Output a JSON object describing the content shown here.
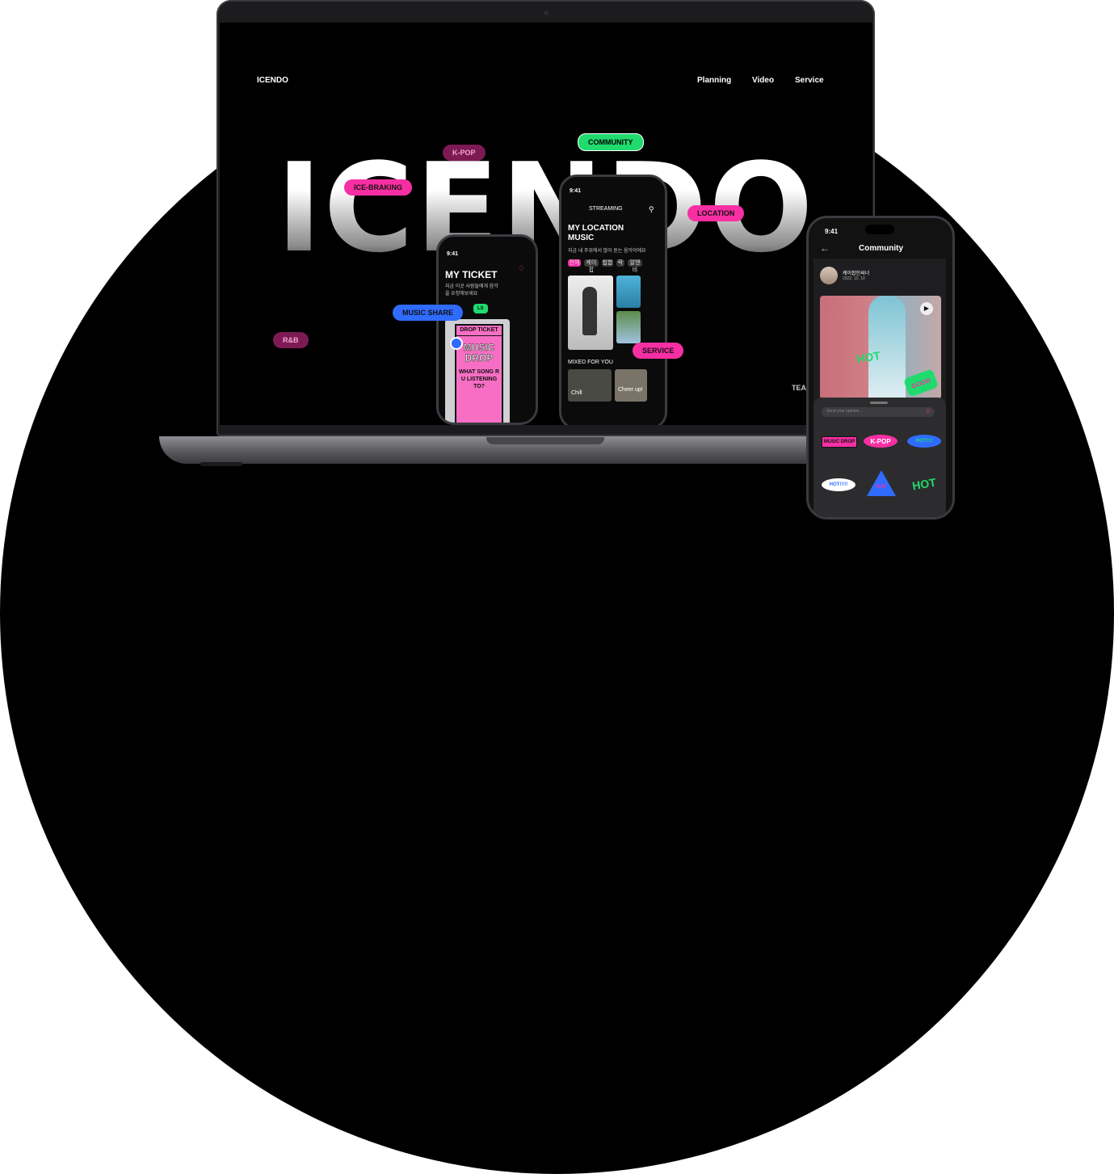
{
  "website": {
    "logo": "ICENDO",
    "nav": [
      "Planning",
      "Video",
      "Service"
    ],
    "hero_title": "ICENDO",
    "tags": {
      "kpop": "K-POP",
      "community": "COMMUNITY",
      "ice_braking": "ICE-BRAKING",
      "location": "LOCATION",
      "music_share": "MUSIC SHARE",
      "service": "SERVICE",
      "rnb": "R&B"
    },
    "corner_text": "TEA",
    "colors": {
      "pink": "#f72fa3",
      "green": "#1fdb6e",
      "blue": "#2f6bff",
      "maroon": "#7d1a54"
    }
  },
  "ticket_phone": {
    "time": "9:41",
    "title": "MY TICKET",
    "subtitle": "지금 이곳 사람들에게 음악을 요청해보세요",
    "badge": "LS",
    "card_header": "DROP TICKET",
    "card_title": "MUSIC DROP",
    "card_question": "WHAT SONG R U LISTENING TO?"
  },
  "streaming_phone": {
    "time": "9:41",
    "header": "STREAMING",
    "title": "MY LOCATION MUSIC",
    "subtitle": "지금 내 주위에서 많이 듣는 음악이에요",
    "chips": [
      "전체",
      "케이팝",
      "힙합",
      "락",
      "알앤비"
    ],
    "section": "MIXED FOR YOU",
    "mixes": [
      "Chill",
      "Cheer up!"
    ]
  },
  "community_phone": {
    "time": "9:41",
    "title": "Community",
    "user_name": "케이팝인싸너",
    "post_date": "2022. 10. 10",
    "input_placeholder": "Send your opinion...",
    "stickers": [
      "MUSIC DROP",
      "K-POP",
      "HOT!!!!",
      "HOT!!!!!",
      "HOT",
      "HOT"
    ],
    "sticker_overlays": [
      "HOT",
      "GOOD"
    ]
  }
}
